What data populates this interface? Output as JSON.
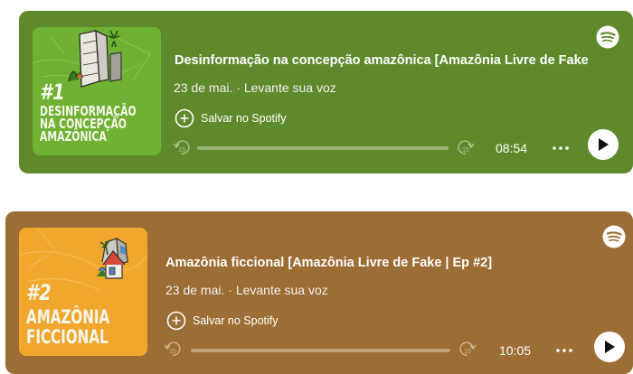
{
  "episodes": [
    {
      "cover": {
        "number": "#1",
        "title": "Desinformação\nna concepção\namazônica",
        "bg_color": "#6fb132"
      },
      "card_color": "#5f8a2c",
      "title": "Desinformação na concepção amazônica [Amazônia Livre de Fake",
      "meta": "23 de mai. · Levante sua voz",
      "save_label": "Salvar no Spotify",
      "skip_back": "15",
      "skip_forward": "15",
      "duration": "08:54",
      "progress": 0,
      "icons": [
        "spotify-icon",
        "plus-circle-icon",
        "skip-back-15-icon",
        "skip-forward-15-icon",
        "more-icon",
        "play-icon"
      ]
    },
    {
      "cover": {
        "number": "#2",
        "title": "Amazônia\nficcional",
        "bg_color": "#f1a62d"
      },
      "card_color": "#9c6d34",
      "title": "Amazônia ficcional [Amazônia Livre de Fake | Ep #2]",
      "meta": "23 de mai. · Levante sua voz",
      "save_label": "Salvar no Spotify",
      "skip_back": "15",
      "skip_forward": "15",
      "duration": "10:05",
      "progress": 0,
      "icons": [
        "spotify-icon",
        "plus-circle-icon",
        "skip-back-15-icon",
        "skip-forward-15-icon",
        "more-icon",
        "play-icon"
      ]
    }
  ]
}
